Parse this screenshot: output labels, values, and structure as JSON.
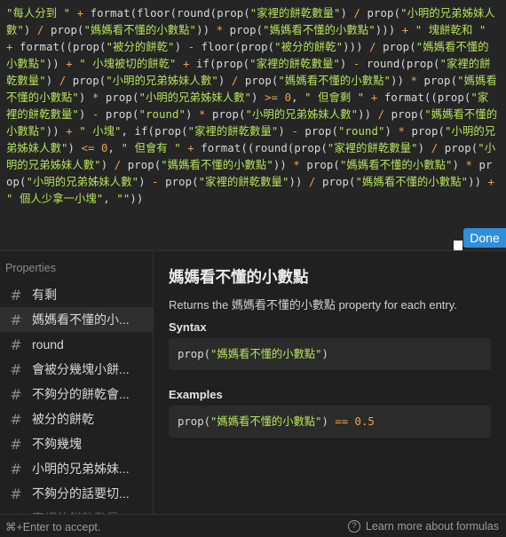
{
  "editor": {
    "tokens": [
      {
        "t": "s",
        "v": "\"每人分到 \""
      },
      {
        "t": "o",
        "v": " + "
      },
      {
        "t": "f",
        "v": "format(floor(round(prop("
      },
      {
        "t": "s",
        "v": "\"家裡的餅乾數量\""
      },
      {
        "t": "f",
        "v": ") "
      },
      {
        "t": "o",
        "v": "/"
      },
      {
        "t": "f",
        "v": " prop("
      },
      {
        "t": "s",
        "v": "\"小明的兄弟姊妹人數\""
      },
      {
        "t": "f",
        "v": ") "
      },
      {
        "t": "o",
        "v": "/"
      },
      {
        "t": "f",
        "v": " prop("
      },
      {
        "t": "s",
        "v": "\"媽媽看不懂的小數點\""
      },
      {
        "t": "f",
        "v": ")) "
      },
      {
        "t": "o",
        "v": "*"
      },
      {
        "t": "f",
        "v": " prop("
      },
      {
        "t": "s",
        "v": "\"媽媽看不懂的小數點\""
      },
      {
        "t": "f",
        "v": "))) "
      },
      {
        "t": "o",
        "v": "+"
      },
      {
        "t": "s",
        "v": " \" 塊餅乾和 \""
      },
      {
        "t": "o",
        "v": " + "
      },
      {
        "t": "f",
        "v": "format((prop("
      },
      {
        "t": "s",
        "v": "\"被分的餅乾\""
      },
      {
        "t": "f",
        "v": ") "
      },
      {
        "t": "o",
        "v": "-"
      },
      {
        "t": "f",
        "v": " floor(prop("
      },
      {
        "t": "s",
        "v": "\"被分的餅乾\""
      },
      {
        "t": "f",
        "v": "))) "
      },
      {
        "t": "o",
        "v": "/"
      },
      {
        "t": "f",
        "v": " prop("
      },
      {
        "t": "s",
        "v": "\"媽媽看不懂的小數點\""
      },
      {
        "t": "f",
        "v": ")) "
      },
      {
        "t": "o",
        "v": "+"
      },
      {
        "t": "s",
        "v": " \" 小塊被切的餅乾\""
      },
      {
        "t": "o",
        "v": " + "
      },
      {
        "t": "f",
        "v": "if(prop("
      },
      {
        "t": "s",
        "v": "\"家裡的餅乾數量\""
      },
      {
        "t": "f",
        "v": ") "
      },
      {
        "t": "o",
        "v": "-"
      },
      {
        "t": "f",
        "v": " round(prop("
      },
      {
        "t": "s",
        "v": "\"家裡的餅乾數量\""
      },
      {
        "t": "f",
        "v": ") "
      },
      {
        "t": "o",
        "v": "/"
      },
      {
        "t": "f",
        "v": " prop("
      },
      {
        "t": "s",
        "v": "\"小明的兄弟姊妹人數\""
      },
      {
        "t": "f",
        "v": ") "
      },
      {
        "t": "o",
        "v": "/"
      },
      {
        "t": "f",
        "v": " prop("
      },
      {
        "t": "s",
        "v": "\"媽媽看不懂的小數點\""
      },
      {
        "t": "f",
        "v": ")) "
      },
      {
        "t": "o",
        "v": "*"
      },
      {
        "t": "f",
        "v": " prop("
      },
      {
        "t": "s",
        "v": "\"媽媽看不懂的小數點\""
      },
      {
        "t": "f",
        "v": ") "
      },
      {
        "t": "o",
        "v": "*"
      },
      {
        "t": "f",
        "v": " prop("
      },
      {
        "t": "s",
        "v": "\"小明的兄弟姊妹人數\""
      },
      {
        "t": "f",
        "v": ") "
      },
      {
        "t": "o",
        "v": ">="
      },
      {
        "t": "n",
        "v": " 0"
      },
      {
        "t": "f",
        "v": ", "
      },
      {
        "t": "s",
        "v": "\" 但會剩 \""
      },
      {
        "t": "o",
        "v": " + "
      },
      {
        "t": "f",
        "v": "format((prop("
      },
      {
        "t": "s",
        "v": "\"家裡的餅乾數量\""
      },
      {
        "t": "f",
        "v": ") "
      },
      {
        "t": "o",
        "v": "-"
      },
      {
        "t": "f",
        "v": " prop("
      },
      {
        "t": "s",
        "v": "\"round\""
      },
      {
        "t": "f",
        "v": ") "
      },
      {
        "t": "o",
        "v": "*"
      },
      {
        "t": "f",
        "v": " prop("
      },
      {
        "t": "s",
        "v": "\"小明的兄弟姊妹人數\""
      },
      {
        "t": "f",
        "v": ")) "
      },
      {
        "t": "o",
        "v": "/"
      },
      {
        "t": "f",
        "v": " prop("
      },
      {
        "t": "s",
        "v": "\"媽媽看不懂的小數點\""
      },
      {
        "t": "f",
        "v": ")) "
      },
      {
        "t": "o",
        "v": "+"
      },
      {
        "t": "s",
        "v": " \" 小塊\""
      },
      {
        "t": "f",
        "v": ", if(prop("
      },
      {
        "t": "s",
        "v": "\"家裡的餅乾數量\""
      },
      {
        "t": "f",
        "v": ") "
      },
      {
        "t": "o",
        "v": "-"
      },
      {
        "t": "f",
        "v": " prop("
      },
      {
        "t": "s",
        "v": "\"round\""
      },
      {
        "t": "f",
        "v": ") "
      },
      {
        "t": "o",
        "v": "*"
      },
      {
        "t": "f",
        "v": " prop("
      },
      {
        "t": "s",
        "v": "\"小明的兄弟姊妹人數\""
      },
      {
        "t": "f",
        "v": ") "
      },
      {
        "t": "o",
        "v": "<="
      },
      {
        "t": "n",
        "v": " 0"
      },
      {
        "t": "f",
        "v": ", "
      },
      {
        "t": "s",
        "v": "\" 但會有 \""
      },
      {
        "t": "o",
        "v": " + "
      },
      {
        "t": "f",
        "v": "format((round(prop("
      },
      {
        "t": "s",
        "v": "\"家裡的餅乾數量\""
      },
      {
        "t": "f",
        "v": ") "
      },
      {
        "t": "o",
        "v": "/"
      },
      {
        "t": "f",
        "v": " prop("
      },
      {
        "t": "s",
        "v": "\"小明的兄弟姊妹人數\""
      },
      {
        "t": "f",
        "v": ") "
      },
      {
        "t": "o",
        "v": "/"
      },
      {
        "t": "f",
        "v": " prop("
      },
      {
        "t": "s",
        "v": "\"媽媽看不懂的小數點\""
      },
      {
        "t": "f",
        "v": ")) "
      },
      {
        "t": "o",
        "v": "*"
      },
      {
        "t": "f",
        "v": " prop("
      },
      {
        "t": "s",
        "v": "\"媽媽看不懂的小數點\""
      },
      {
        "t": "f",
        "v": ") "
      },
      {
        "t": "o",
        "v": "*"
      },
      {
        "t": "f",
        "v": " prop("
      },
      {
        "t": "s",
        "v": "\"小明的兄弟姊妹人數\""
      },
      {
        "t": "f",
        "v": ") "
      },
      {
        "t": "o",
        "v": "-"
      },
      {
        "t": "f",
        "v": " prop("
      },
      {
        "t": "s",
        "v": "\"家裡的餅乾數量\""
      },
      {
        "t": "f",
        "v": ")) "
      },
      {
        "t": "o",
        "v": "/"
      },
      {
        "t": "f",
        "v": " prop("
      },
      {
        "t": "s",
        "v": "\"媽媽看不懂的小數點\""
      },
      {
        "t": "f",
        "v": ")) "
      },
      {
        "t": "o",
        "v": "+"
      },
      {
        "t": "s",
        "v": " \" 個人少拿一小塊\""
      },
      {
        "t": "f",
        "v": ", "
      },
      {
        "t": "s",
        "v": "\"\""
      },
      {
        "t": "f",
        "v": "))"
      }
    ],
    "done_label": "Done"
  },
  "sidebar": {
    "heading": "Properties",
    "items": [
      {
        "label": "有剩",
        "selected": false,
        "faded": false
      },
      {
        "label": "媽媽看不懂的小...",
        "selected": true,
        "faded": false
      },
      {
        "label": "round",
        "selected": false,
        "faded": false
      },
      {
        "label": "會被分幾塊小餅...",
        "selected": false,
        "faded": false
      },
      {
        "label": "不夠分的餅乾會...",
        "selected": false,
        "faded": false
      },
      {
        "label": "被分的餅乾",
        "selected": false,
        "faded": false
      },
      {
        "label": "不夠幾塊",
        "selected": false,
        "faded": false
      },
      {
        "label": "小明的兄弟姊妹...",
        "selected": false,
        "faded": false
      },
      {
        "label": "不夠分的話要切...",
        "selected": false,
        "faded": false
      },
      {
        "label": "家裡的餅乾數量",
        "selected": false,
        "faded": true
      }
    ]
  },
  "detail": {
    "title": "媽媽看不懂的小數點",
    "desc_prefix": "Returns the ",
    "desc_prop": "媽媽看不懂的小數點",
    "desc_suffix": " property for each entry.",
    "syntax_label": "Syntax",
    "syntax_fn": "prop(",
    "syntax_arg": "\"媽媽看不懂的小數點\"",
    "syntax_close": ")",
    "examples_label": "Examples",
    "example_fn": "prop(",
    "example_arg": "\"媽媽看不懂的小數點\"",
    "example_close": ")",
    "example_op": " == ",
    "example_val": "0.5"
  },
  "footer": {
    "hint": "⌘+Enter to accept.",
    "help_symbol": "?",
    "learn_more": "Learn more about formulas"
  },
  "colors": {
    "string": "#b6e15a",
    "operator": "#f0a24a",
    "accent": "#2f8fd8"
  }
}
